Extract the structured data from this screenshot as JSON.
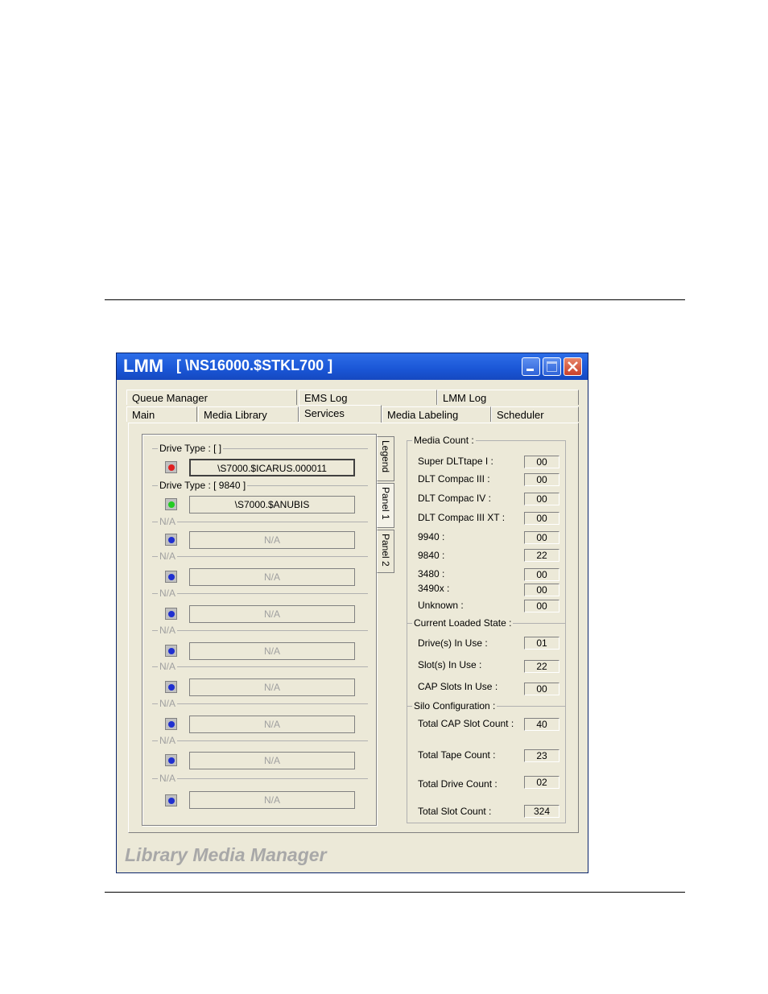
{
  "window": {
    "app": "LMM",
    "path": "[ \\NS16000.$STKL700 ]"
  },
  "tabs_row1": [
    "Queue Manager",
    "EMS Log",
    "LMM Log"
  ],
  "tabs_row2": [
    "Main",
    "Media Library",
    "Services",
    "Media Labeling",
    "Scheduler"
  ],
  "active_tab": "Services",
  "side_tabs": [
    "Legend",
    "Panel 1",
    "Panel 2"
  ],
  "drives": [
    {
      "group": "Drive Type : [ ]",
      "name": "\\S7000.$ICARUS.000011",
      "led": "#e02020"
    },
    {
      "group": "Drive Type : [ 9840 ]",
      "name": "\\S7000.$ANUBIS",
      "led": "#22cc22"
    },
    {
      "group": "N/A",
      "name": "N/A",
      "led": "#1f2fd0"
    },
    {
      "group": "N/A",
      "name": "N/A",
      "led": "#1f2fd0"
    },
    {
      "group": "N/A",
      "name": "N/A",
      "led": "#1f2fd0"
    },
    {
      "group": "N/A",
      "name": "N/A",
      "led": "#1f2fd0"
    },
    {
      "group": "N/A",
      "name": "N/A",
      "led": "#1f2fd0"
    },
    {
      "group": "N/A",
      "name": "N/A",
      "led": "#1f2fd0"
    },
    {
      "group": "N/A",
      "name": "N/A",
      "led": "#1f2fd0"
    },
    {
      "group": "N/A",
      "name": "N/A",
      "led": "#1f2fd0"
    }
  ],
  "media_count": {
    "title": "Media Count :",
    "rows": [
      {
        "label": "Super DLTtape I :",
        "value": "00"
      },
      {
        "label": "DLT Compac III :",
        "value": "00"
      },
      {
        "label": "DLT Compac IV :",
        "value": "00"
      },
      {
        "label": "DLT Compac III XT :",
        "value": "00"
      },
      {
        "label": "9940 :",
        "value": "00"
      },
      {
        "label": "9840 :",
        "value": "22"
      },
      {
        "label": "3480 :",
        "value": "00"
      },
      {
        "label": "3490x :",
        "value": "00"
      },
      {
        "label": "Unknown :",
        "value": "00"
      }
    ]
  },
  "loaded_state": {
    "title": "Current Loaded State :",
    "rows": [
      {
        "label": "Drive(s) In Use :",
        "value": "01"
      },
      {
        "label": "Slot(s) In Use :",
        "value": "22"
      },
      {
        "label": "CAP Slots In Use :",
        "value": "00"
      }
    ]
  },
  "silo": {
    "title": "Silo Configuration :",
    "rows": [
      {
        "label": "Total CAP Slot Count :",
        "value": "40"
      },
      {
        "label": "Total Tape Count :",
        "value": "23"
      },
      {
        "label": "Total Drive Count :",
        "value": "02"
      },
      {
        "label": "Total Slot Count :",
        "value": "324"
      }
    ]
  },
  "footer": "Library Media Manager"
}
